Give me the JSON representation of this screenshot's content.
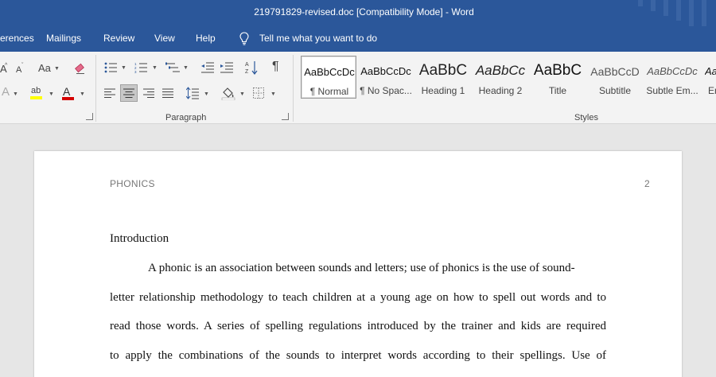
{
  "window": {
    "title": "219791829-revised.doc  [Compatibility Mode]  -  Word",
    "colors": {
      "title_bar": "#2b579a",
      "ribbon": "#f3f3f3",
      "canvas": "#e6e6e6"
    }
  },
  "tabs": [
    {
      "label": "erences"
    },
    {
      "label": "Mailings"
    },
    {
      "label": "Review"
    },
    {
      "label": "View"
    },
    {
      "label": "Help"
    }
  ],
  "tell_me": {
    "label": "Tell me what you want to do",
    "icon": "lightbulb-icon"
  },
  "font_group": {
    "grow_font": "A",
    "shrink_font": "A",
    "change_case": "Aa",
    "clear_formatting_icon": "eraser-icon",
    "text_effects": "A",
    "highlight": "ab",
    "font_color": "A",
    "colors": {
      "highlight": "#ffff00",
      "font_color": "#d40000"
    }
  },
  "paragraph_group": {
    "label": "Paragraph"
  },
  "styles_group": {
    "label": "Styles",
    "items": [
      {
        "preview": "AaBbCcDc",
        "name": "¶ Normal",
        "selected": true
      },
      {
        "preview": "AaBbCcDc",
        "name": "¶ No Spac..."
      },
      {
        "preview": "AaBbC",
        "name": "Heading 1"
      },
      {
        "preview": "AaBbCc",
        "name": "Heading 2"
      },
      {
        "preview": "AaBbC",
        "name": "Title"
      },
      {
        "preview": "AaBbCcD",
        "name": "Subtitle"
      },
      {
        "preview": "AaBbCcDc",
        "name": "Subtle Em..."
      },
      {
        "preview": "Aa",
        "name": "Em"
      }
    ]
  },
  "document": {
    "header": "PHONICS",
    "page_number": "2",
    "heading": "Introduction",
    "lines": [
      "A phonic is an association between sounds and letters; use of phonics is the use of sound-",
      "letter relationship methodology to teach children at a young age on how to spell out words and to",
      "read those words. A series of spelling regulations introduced by the trainer and kids are required",
      "to apply the combinations of the sounds to interpret words according to their spellings. Use of"
    ]
  }
}
